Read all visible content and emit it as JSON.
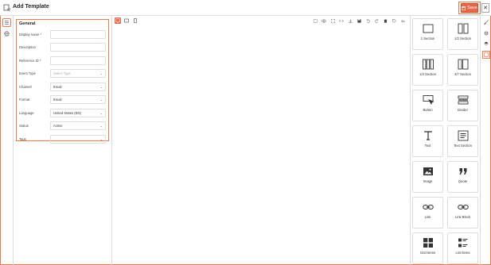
{
  "header": {
    "title": "Add Template",
    "save_label": "Save",
    "close_label": "✕"
  },
  "form": {
    "section_title": "General",
    "fields": [
      {
        "label": "Display name *",
        "value": "",
        "type": "text"
      },
      {
        "label": "Description",
        "value": "",
        "type": "text"
      },
      {
        "label": "Reference ID *",
        "value": "",
        "type": "text"
      },
      {
        "label": "Event Type",
        "value": "Select Type",
        "type": "select",
        "placeholder": true
      },
      {
        "label": "Channel",
        "value": "Email",
        "type": "select"
      },
      {
        "label": "Format",
        "value": "Email",
        "type": "select"
      },
      {
        "label": "Language",
        "value": "United States (EN)",
        "type": "select"
      },
      {
        "label": "Status",
        "value": "Active",
        "type": "select"
      },
      {
        "label": "Tags",
        "value": "",
        "type": "select"
      }
    ]
  },
  "blocks": [
    {
      "label": "1 Section",
      "icon": "one-section-icon"
    },
    {
      "label": "1/2 Section",
      "icon": "half-section-icon"
    },
    {
      "label": "1/3 Section",
      "icon": "third-section-icon"
    },
    {
      "label": "3/7 Section",
      "icon": "three-seven-section-icon"
    },
    {
      "label": "Button",
      "icon": "button-icon"
    },
    {
      "label": "Divider",
      "icon": "divider-icon"
    },
    {
      "label": "Text",
      "icon": "text-icon"
    },
    {
      "label": "Text Section",
      "icon": "text-section-icon"
    },
    {
      "label": "Image",
      "icon": "image-icon"
    },
    {
      "label": "Quote",
      "icon": "quote-icon"
    },
    {
      "label": "Link",
      "icon": "link-icon"
    },
    {
      "label": "Link Block",
      "icon": "link-block-icon"
    },
    {
      "label": "Grid Items",
      "icon": "grid-items-icon"
    },
    {
      "label": "List Items",
      "icon": "list-items-icon"
    }
  ],
  "colors": {
    "accent": "#e8674a",
    "border": "#dddddd"
  }
}
